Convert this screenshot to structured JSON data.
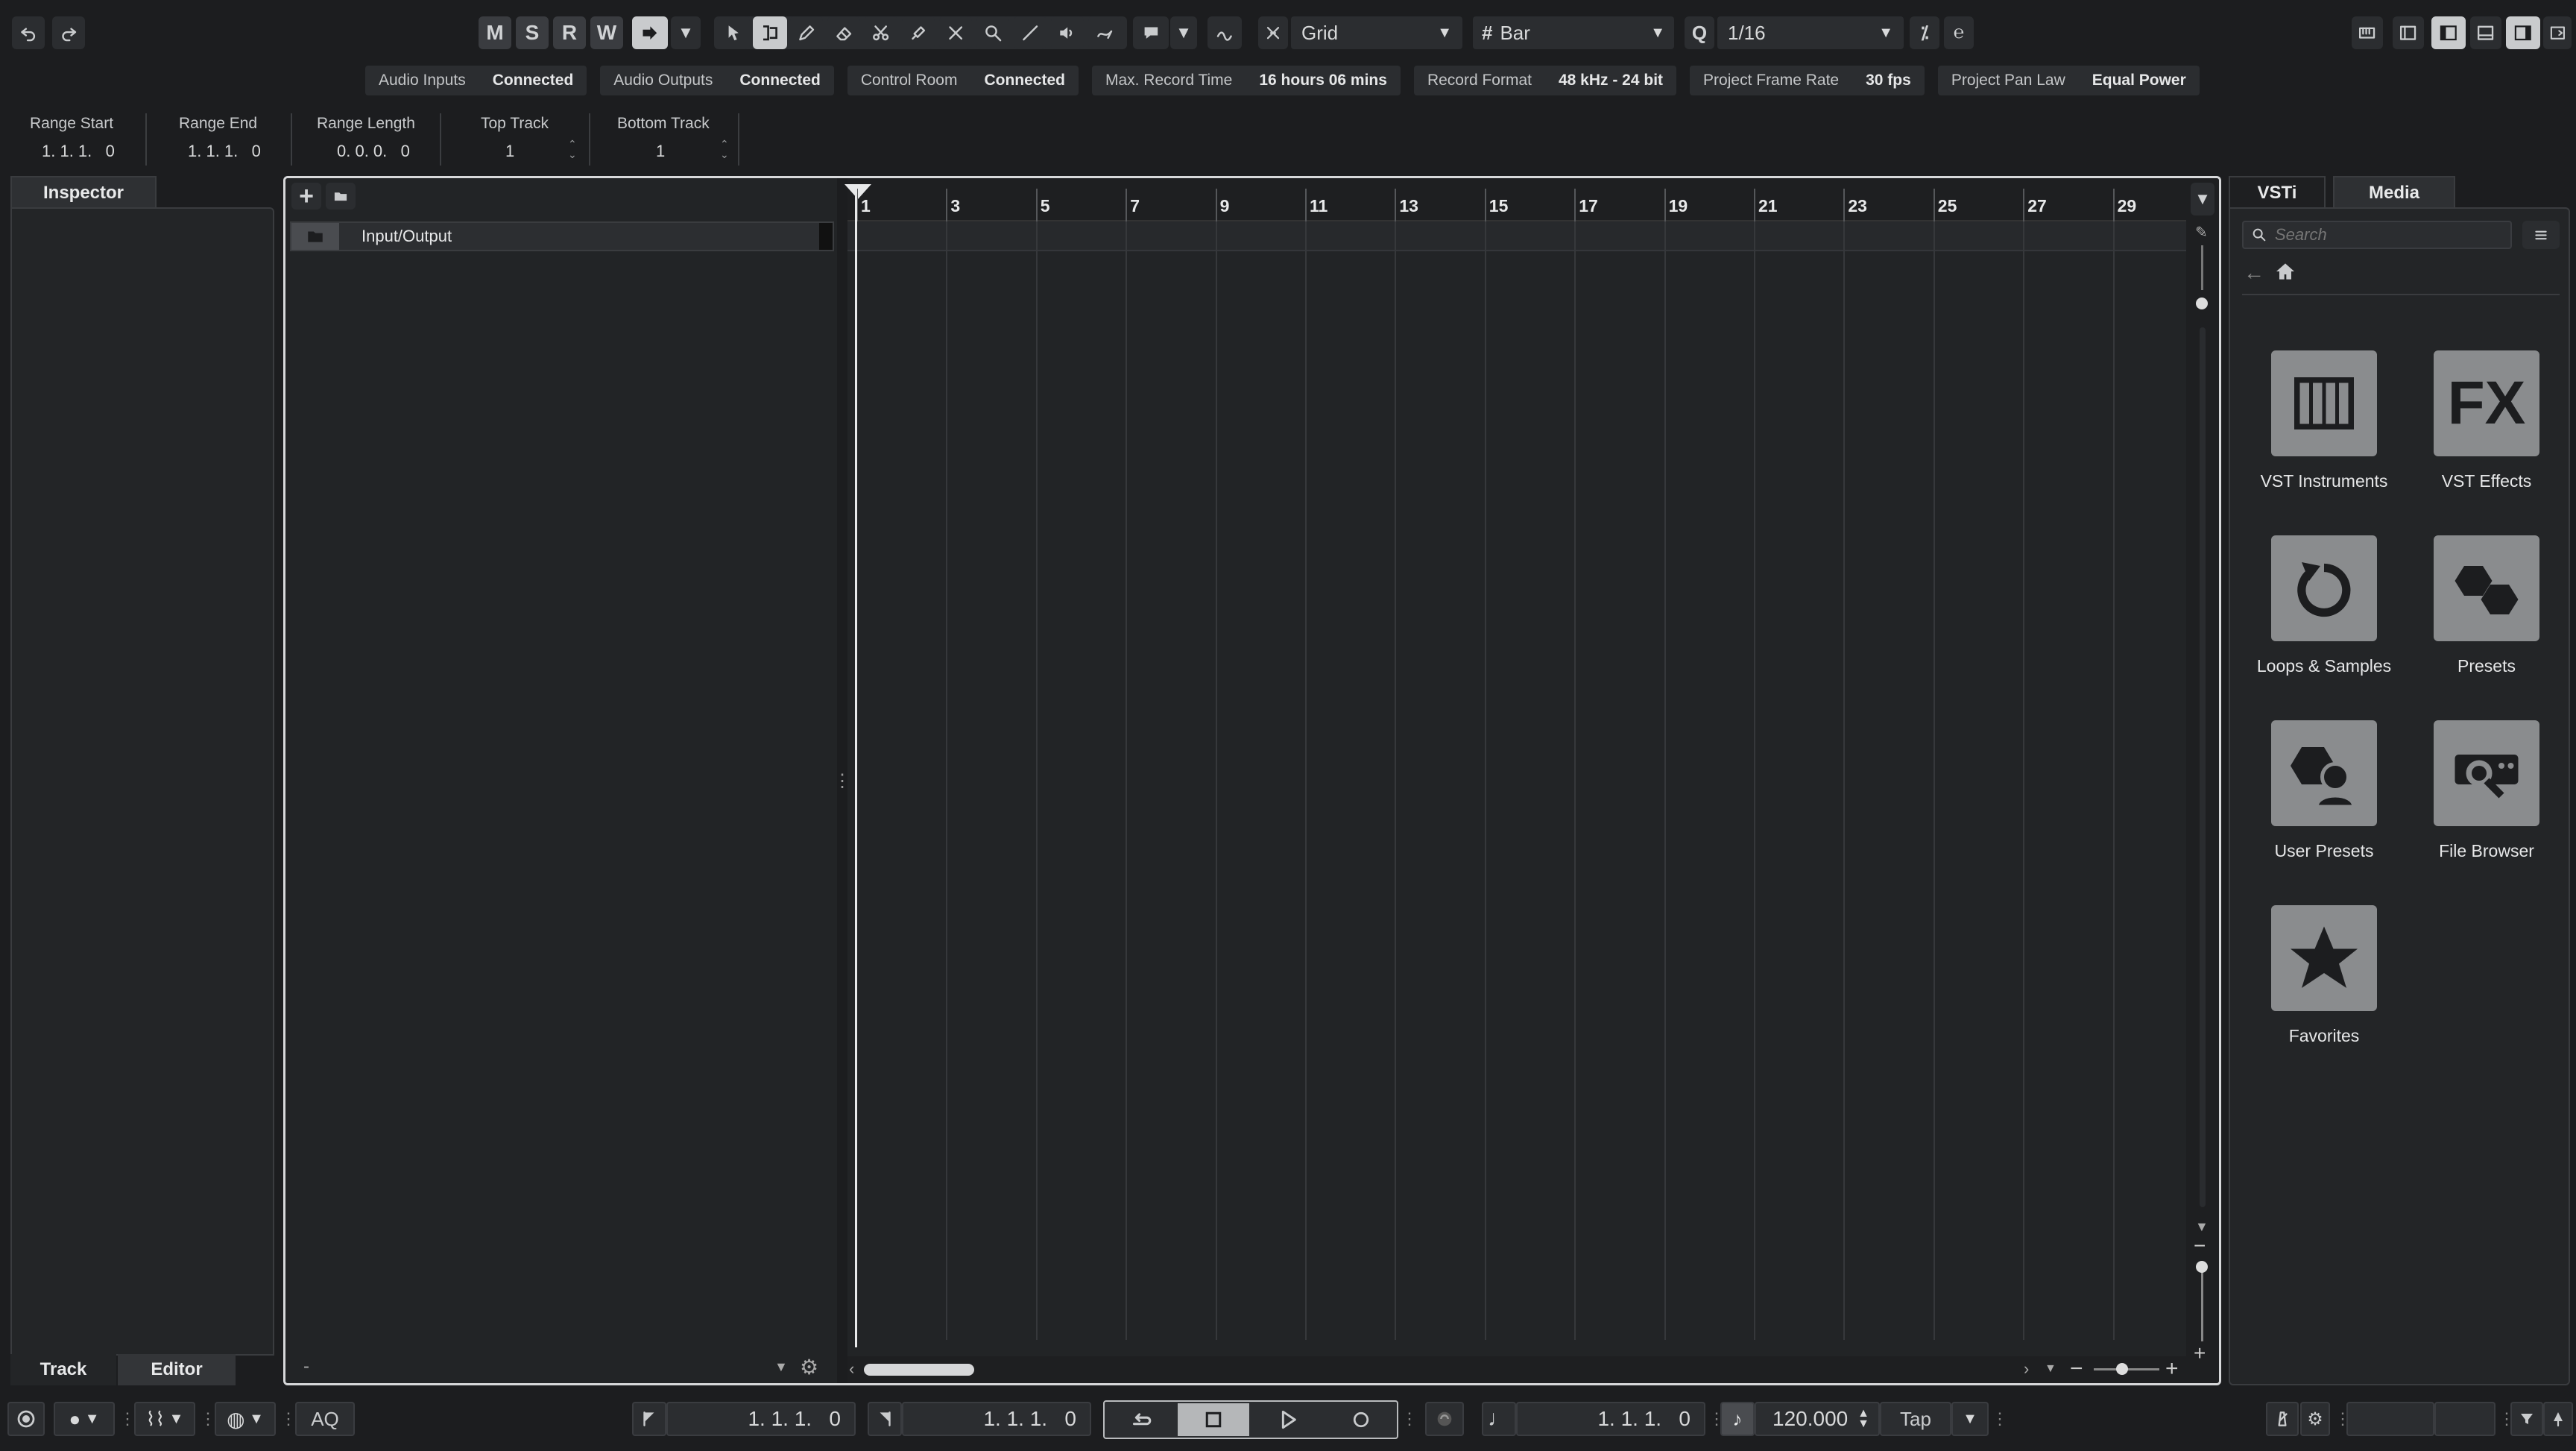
{
  "toolbar": {
    "mute": "M",
    "solo": "S",
    "read": "R",
    "write": "W",
    "snap_type": "Grid",
    "grid_type": "Bar",
    "quantize_label": "Q",
    "quantize_value": "1/16"
  },
  "status": [
    {
      "label": "Audio Inputs",
      "value": "Connected"
    },
    {
      "label": "Audio Outputs",
      "value": "Connected"
    },
    {
      "label": "Control Room",
      "value": "Connected"
    },
    {
      "label": "Max. Record Time",
      "value": "16 hours 06 mins"
    },
    {
      "label": "Record Format",
      "value": "48 kHz - 24 bit"
    },
    {
      "label": "Project Frame Rate",
      "value": "30 fps"
    },
    {
      "label": "Project Pan Law",
      "value": "Equal Power"
    }
  ],
  "infoline": {
    "range_start_label": "Range Start",
    "range_start": "1. 1. 1.   0",
    "range_end_label": "Range End",
    "range_end": "1. 1. 1.   0",
    "range_length_label": "Range Length",
    "range_length": "0. 0. 0.   0",
    "top_track_label": "Top Track",
    "top_track": "1",
    "bottom_track_label": "Bottom Track",
    "bottom_track": "1"
  },
  "inspector": {
    "title": "Inspector",
    "tab_track": "Track",
    "tab_editor": "Editor"
  },
  "tracklist": {
    "folder_name": "Input/Output",
    "bottom_dash": "-"
  },
  "ruler": {
    "bars": [
      "1",
      "3",
      "5",
      "7",
      "9",
      "11",
      "13",
      "15",
      "17",
      "19",
      "21",
      "23",
      "25",
      "27",
      "29"
    ]
  },
  "media": {
    "tab_vsti": "VSTi",
    "tab_media": "Media",
    "search_placeholder": "Search",
    "tiles": [
      {
        "label": "VST Instruments",
        "icon": "piano-keys-icon"
      },
      {
        "label": "VST Effects",
        "icon": "fx-icon",
        "glyph": "FX"
      },
      {
        "label": "Loops & Samples",
        "icon": "loop-icon"
      },
      {
        "label": "Presets",
        "icon": "hexagons-icon"
      },
      {
        "label": "User Presets",
        "icon": "user-preset-icon"
      },
      {
        "label": "File Browser",
        "icon": "file-browser-icon"
      },
      {
        "label": "Favorites",
        "icon": "star-icon"
      }
    ]
  },
  "transport": {
    "aq": "AQ",
    "left_locator": "1. 1. 1.   0",
    "right_locator": "1. 1. 1.   0",
    "position": "1. 1. 1.   0",
    "tempo": "120.000",
    "tap": "Tap"
  }
}
